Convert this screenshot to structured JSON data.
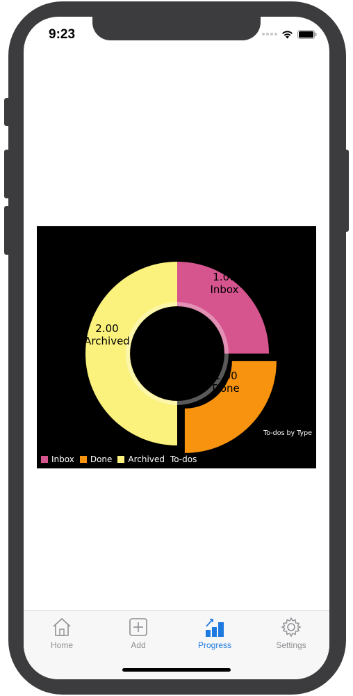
{
  "status_bar": {
    "time": "9:23"
  },
  "colors": {
    "inbox": "#d6558e",
    "done": "#f7930f",
    "archived": "#fbf27d",
    "chart_bg": "#000000",
    "tab_active": "#1f7ae0",
    "tab_inactive": "#8e8e93"
  },
  "chart_data": {
    "type": "pie",
    "variant": "donut",
    "title": "To-dos by Type",
    "legend_title": "To-dos",
    "legend_position": "bottom-left",
    "categories": [
      "Inbox",
      "Done",
      "Archived"
    ],
    "values": [
      1.0,
      1.0,
      2.0
    ],
    "value_labels": [
      "1.00",
      "1.00",
      "2.00"
    ],
    "exploded": [
      "Done"
    ]
  },
  "tabs": [
    {
      "label": "Home",
      "icon": "home-icon",
      "active": false
    },
    {
      "label": "Add",
      "icon": "add-icon",
      "active": false
    },
    {
      "label": "Progress",
      "icon": "progress-chart-icon",
      "active": true
    },
    {
      "label": "Settings",
      "icon": "gear-icon",
      "active": false
    }
  ]
}
